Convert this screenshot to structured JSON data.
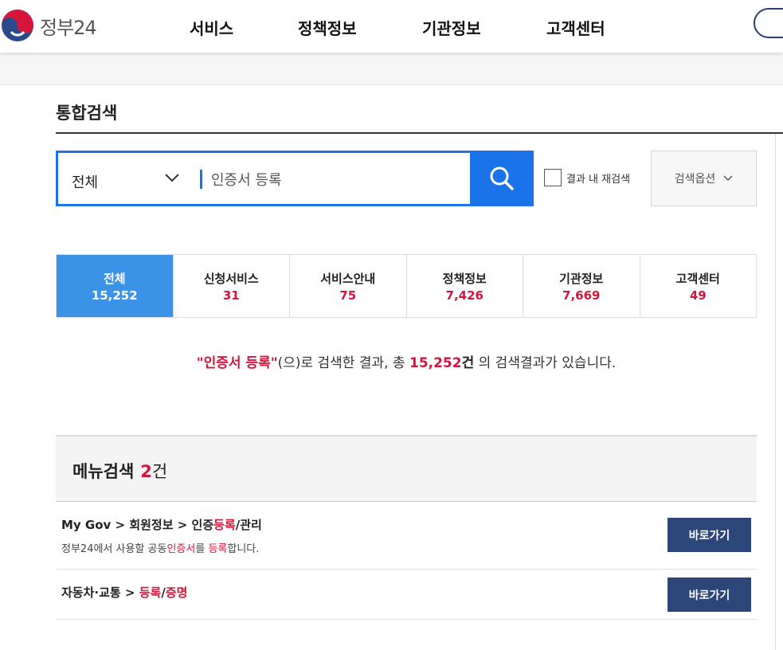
{
  "header": {
    "logo_text": "정부24",
    "nav": [
      "서비스",
      "정책정보",
      "기관정보",
      "고객센터"
    ]
  },
  "page": {
    "title": "통합검색"
  },
  "search": {
    "scope": "전체",
    "query": "인증서 등록",
    "recheck_label": "결과 내 재검색",
    "options_label": "검색옵션"
  },
  "tabs": [
    {
      "name": "전체",
      "count": "15,252",
      "active": true
    },
    {
      "name": "신청서비스",
      "count": "31"
    },
    {
      "name": "서비스안내",
      "count": "75"
    },
    {
      "name": "정책정보",
      "count": "7,426"
    },
    {
      "name": "기관정보",
      "count": "7,669"
    },
    {
      "name": "고객센터",
      "count": "49"
    }
  ],
  "summary": {
    "quoted_query": "\"인증서 등록\"",
    "text1": "(으)로 검색한 결과, 총 ",
    "total": "15,252",
    "unit": "건",
    "text2": " 의 검색결과가 있습니다."
  },
  "menu_search": {
    "title": "메뉴검색",
    "count": "2",
    "unit": "건",
    "results": [
      {
        "path_prefix": "My Gov > 회원정보 > 인증",
        "path_hl": "등록",
        "path_suffix": "/관리",
        "desc_a": "정부24에서 사용할 공동",
        "desc_hl1": "인증서",
        "desc_b": "를 ",
        "desc_hl2": "등록",
        "desc_c": "합니다.",
        "button": "바로가기"
      },
      {
        "path_prefix": "자동차·교통 > ",
        "path_hl": "등록",
        "path_mid": "/",
        "path_hl2": "증명",
        "button": "바로가기"
      }
    ]
  },
  "colors": {
    "primary": "#1a73e8",
    "active_tab": "#3b93e8",
    "highlight": "#d6153b",
    "navy_button": "#2c4679"
  },
  "icons": {
    "logo": "taegeuk-logo-icon",
    "search": "search-icon",
    "dropdown": "chevron-down-icon"
  }
}
